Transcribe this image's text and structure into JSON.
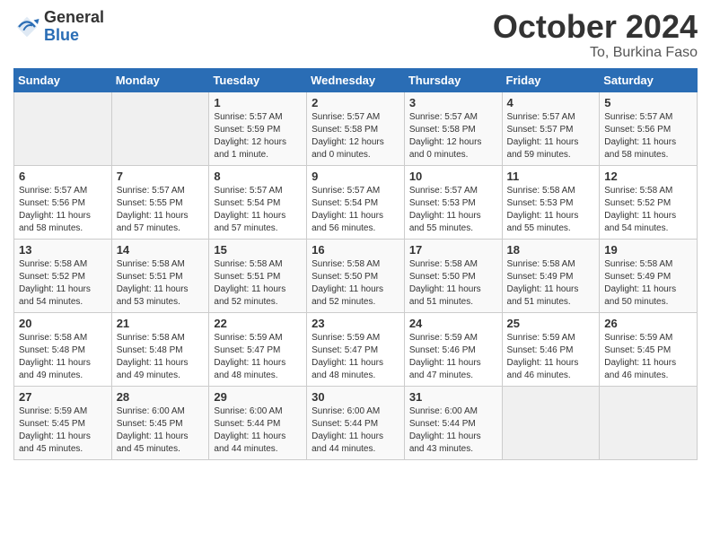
{
  "header": {
    "logo_general": "General",
    "logo_blue": "Blue",
    "month_title": "October 2024",
    "location": "To, Burkina Faso"
  },
  "days_of_week": [
    "Sunday",
    "Monday",
    "Tuesday",
    "Wednesday",
    "Thursday",
    "Friday",
    "Saturday"
  ],
  "weeks": [
    [
      {
        "day": "",
        "info": ""
      },
      {
        "day": "",
        "info": ""
      },
      {
        "day": "1",
        "info": "Sunrise: 5:57 AM\nSunset: 5:59 PM\nDaylight: 12 hours\nand 1 minute."
      },
      {
        "day": "2",
        "info": "Sunrise: 5:57 AM\nSunset: 5:58 PM\nDaylight: 12 hours\nand 0 minutes."
      },
      {
        "day": "3",
        "info": "Sunrise: 5:57 AM\nSunset: 5:58 PM\nDaylight: 12 hours\nand 0 minutes."
      },
      {
        "day": "4",
        "info": "Sunrise: 5:57 AM\nSunset: 5:57 PM\nDaylight: 11 hours\nand 59 minutes."
      },
      {
        "day": "5",
        "info": "Sunrise: 5:57 AM\nSunset: 5:56 PM\nDaylight: 11 hours\nand 58 minutes."
      }
    ],
    [
      {
        "day": "6",
        "info": "Sunrise: 5:57 AM\nSunset: 5:56 PM\nDaylight: 11 hours\nand 58 minutes."
      },
      {
        "day": "7",
        "info": "Sunrise: 5:57 AM\nSunset: 5:55 PM\nDaylight: 11 hours\nand 57 minutes."
      },
      {
        "day": "8",
        "info": "Sunrise: 5:57 AM\nSunset: 5:54 PM\nDaylight: 11 hours\nand 57 minutes."
      },
      {
        "day": "9",
        "info": "Sunrise: 5:57 AM\nSunset: 5:54 PM\nDaylight: 11 hours\nand 56 minutes."
      },
      {
        "day": "10",
        "info": "Sunrise: 5:57 AM\nSunset: 5:53 PM\nDaylight: 11 hours\nand 55 minutes."
      },
      {
        "day": "11",
        "info": "Sunrise: 5:58 AM\nSunset: 5:53 PM\nDaylight: 11 hours\nand 55 minutes."
      },
      {
        "day": "12",
        "info": "Sunrise: 5:58 AM\nSunset: 5:52 PM\nDaylight: 11 hours\nand 54 minutes."
      }
    ],
    [
      {
        "day": "13",
        "info": "Sunrise: 5:58 AM\nSunset: 5:52 PM\nDaylight: 11 hours\nand 54 minutes."
      },
      {
        "day": "14",
        "info": "Sunrise: 5:58 AM\nSunset: 5:51 PM\nDaylight: 11 hours\nand 53 minutes."
      },
      {
        "day": "15",
        "info": "Sunrise: 5:58 AM\nSunset: 5:51 PM\nDaylight: 11 hours\nand 52 minutes."
      },
      {
        "day": "16",
        "info": "Sunrise: 5:58 AM\nSunset: 5:50 PM\nDaylight: 11 hours\nand 52 minutes."
      },
      {
        "day": "17",
        "info": "Sunrise: 5:58 AM\nSunset: 5:50 PM\nDaylight: 11 hours\nand 51 minutes."
      },
      {
        "day": "18",
        "info": "Sunrise: 5:58 AM\nSunset: 5:49 PM\nDaylight: 11 hours\nand 51 minutes."
      },
      {
        "day": "19",
        "info": "Sunrise: 5:58 AM\nSunset: 5:49 PM\nDaylight: 11 hours\nand 50 minutes."
      }
    ],
    [
      {
        "day": "20",
        "info": "Sunrise: 5:58 AM\nSunset: 5:48 PM\nDaylight: 11 hours\nand 49 minutes."
      },
      {
        "day": "21",
        "info": "Sunrise: 5:58 AM\nSunset: 5:48 PM\nDaylight: 11 hours\nand 49 minutes."
      },
      {
        "day": "22",
        "info": "Sunrise: 5:59 AM\nSunset: 5:47 PM\nDaylight: 11 hours\nand 48 minutes."
      },
      {
        "day": "23",
        "info": "Sunrise: 5:59 AM\nSunset: 5:47 PM\nDaylight: 11 hours\nand 48 minutes."
      },
      {
        "day": "24",
        "info": "Sunrise: 5:59 AM\nSunset: 5:46 PM\nDaylight: 11 hours\nand 47 minutes."
      },
      {
        "day": "25",
        "info": "Sunrise: 5:59 AM\nSunset: 5:46 PM\nDaylight: 11 hours\nand 46 minutes."
      },
      {
        "day": "26",
        "info": "Sunrise: 5:59 AM\nSunset: 5:45 PM\nDaylight: 11 hours\nand 46 minutes."
      }
    ],
    [
      {
        "day": "27",
        "info": "Sunrise: 5:59 AM\nSunset: 5:45 PM\nDaylight: 11 hours\nand 45 minutes."
      },
      {
        "day": "28",
        "info": "Sunrise: 6:00 AM\nSunset: 5:45 PM\nDaylight: 11 hours\nand 45 minutes."
      },
      {
        "day": "29",
        "info": "Sunrise: 6:00 AM\nSunset: 5:44 PM\nDaylight: 11 hours\nand 44 minutes."
      },
      {
        "day": "30",
        "info": "Sunrise: 6:00 AM\nSunset: 5:44 PM\nDaylight: 11 hours\nand 44 minutes."
      },
      {
        "day": "31",
        "info": "Sunrise: 6:00 AM\nSunset: 5:44 PM\nDaylight: 11 hours\nand 43 minutes."
      },
      {
        "day": "",
        "info": ""
      },
      {
        "day": "",
        "info": ""
      }
    ]
  ]
}
